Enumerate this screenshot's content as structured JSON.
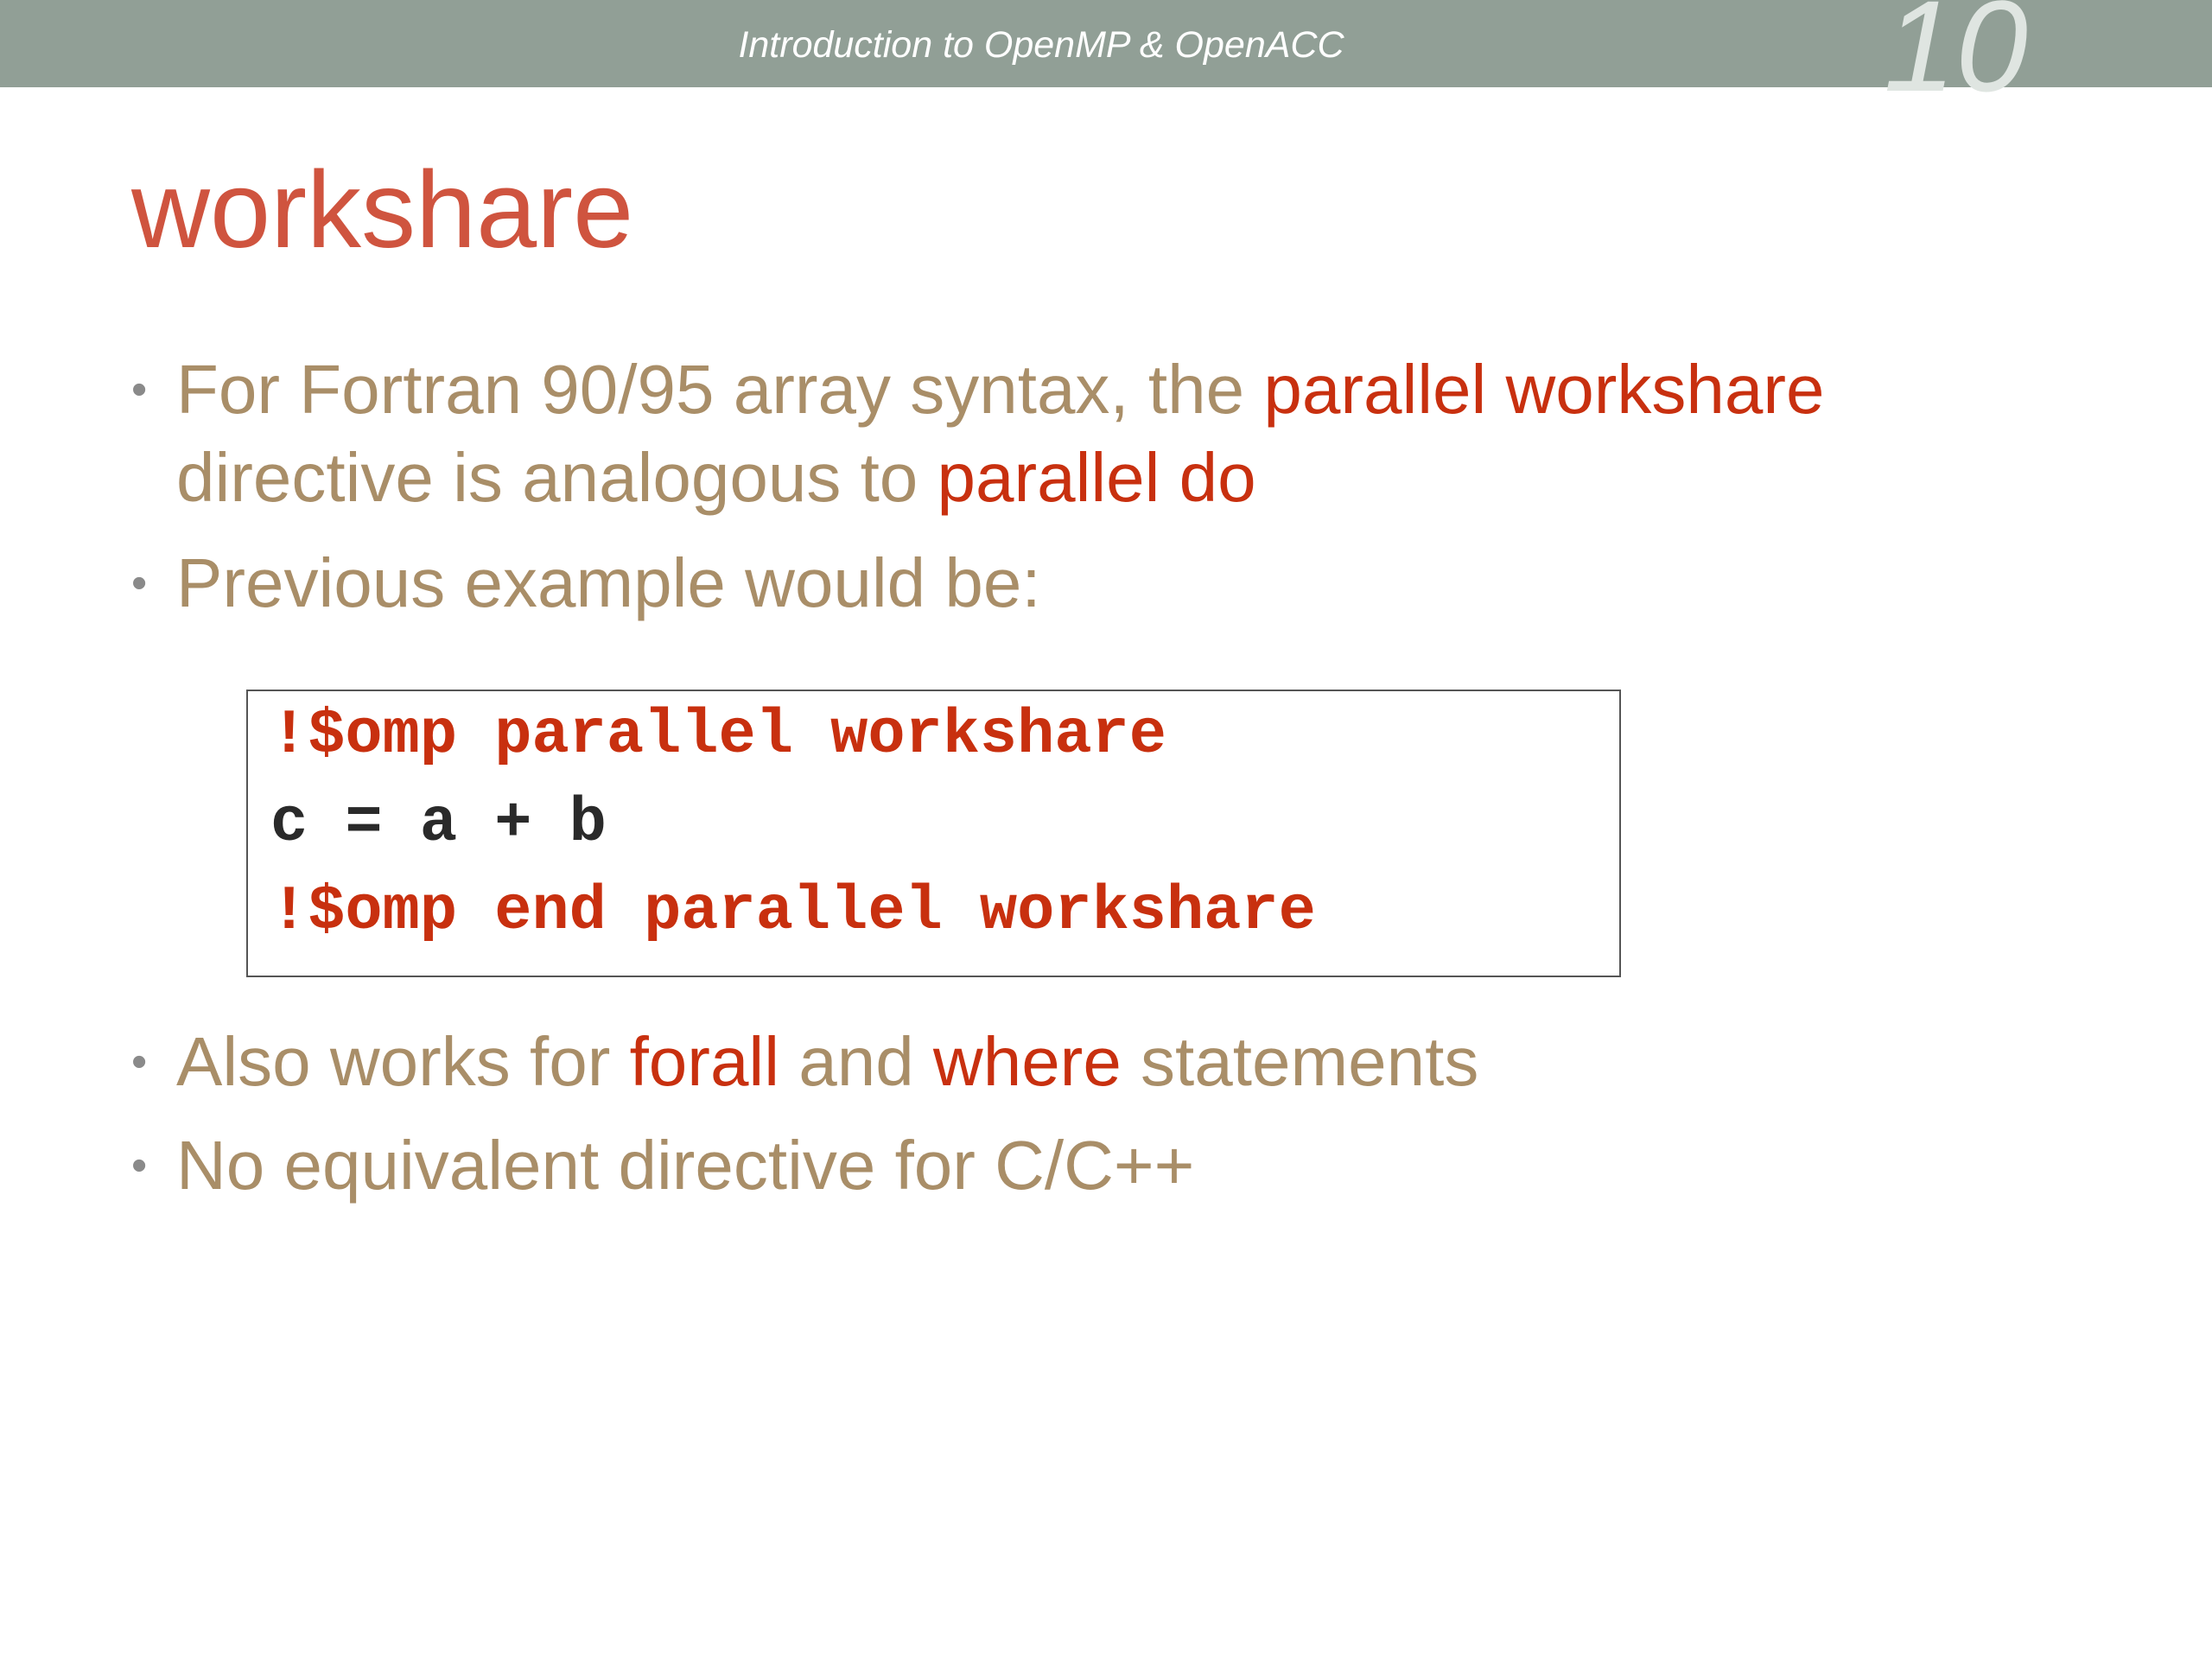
{
  "header": {
    "title": "Introduction  to  OpenMP & OpenACC",
    "slide_number": "10"
  },
  "slide": {
    "title": "workshare",
    "bullets": [
      {
        "parts": [
          {
            "text": "For Fortran 90/95 array syntax, the ",
            "highlight": false
          },
          {
            "text": "parallel workshare",
            "highlight": true
          },
          {
            "text": " directive is analogous to ",
            "highlight": false
          },
          {
            "text": "parallel do",
            "highlight": true
          }
        ]
      },
      {
        "parts": [
          {
            "text": "Previous example would be:",
            "highlight": false
          }
        ]
      },
      {
        "parts": [
          {
            "text": "Also works for ",
            "highlight": false
          },
          {
            "text": "forall",
            "highlight": true
          },
          {
            "text": " and ",
            "highlight": false
          },
          {
            "text": "where",
            "highlight": true
          },
          {
            "text": " statements",
            "highlight": false
          }
        ]
      },
      {
        "parts": [
          {
            "text": "No equivalent directive for C/C++",
            "highlight": false
          }
        ]
      }
    ],
    "code": {
      "lines": [
        {
          "text": "!$omp parallel workshare",
          "kind": "directive"
        },
        {
          "text": "c = a + b",
          "kind": "statement"
        },
        {
          "text": "!$omp end parallel workshare",
          "kind": "directive"
        }
      ]
    }
  },
  "colors": {
    "header_bar": "#919f96",
    "title": "#cf543f",
    "body_text": "#a98e68",
    "highlight": "#c8300f",
    "code_statement": "#2a2a2a"
  },
  "icons": {
    "bullet": "bullet-dot-icon",
    "bullet_glyph": "•"
  }
}
